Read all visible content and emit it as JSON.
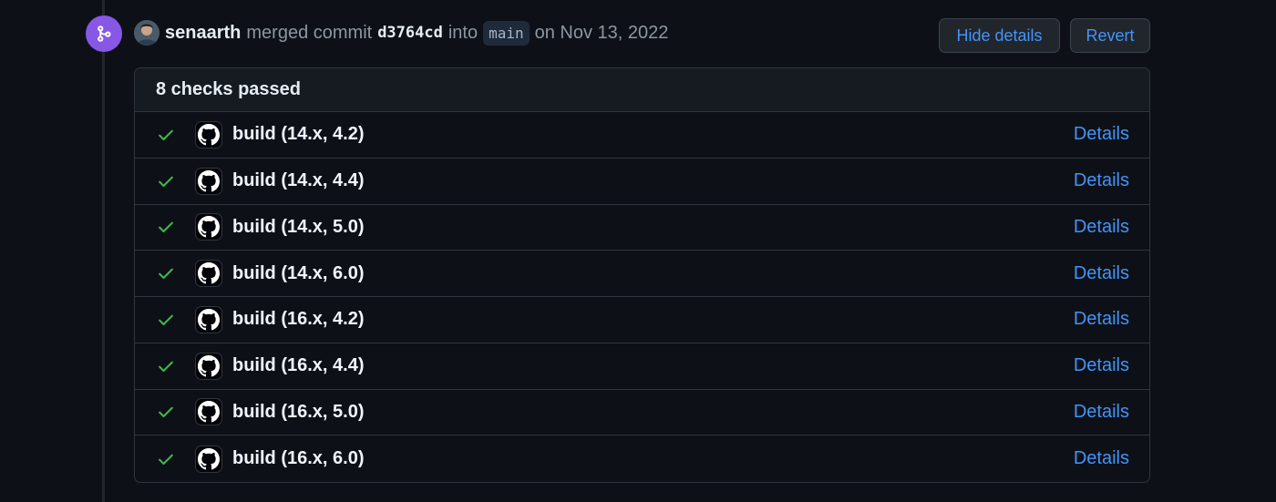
{
  "event": {
    "author": "senaarth",
    "verb": "merged commit",
    "sha": "d3764cd",
    "into": "into",
    "branch": "main",
    "date": "on Nov 13, 2022",
    "merge_badge_color": "#8957e5"
  },
  "buttons": {
    "hide_details": "Hide details",
    "revert": "Revert"
  },
  "checks": {
    "summary": "8 checks passed",
    "details_label": "Details",
    "status_color": "#3fb950",
    "link_color": "#4493f8",
    "items": [
      {
        "name": "build (14.x, 4.2)",
        "status": "success",
        "icon": "github-logo-icon"
      },
      {
        "name": "build (14.x, 4.4)",
        "status": "success",
        "icon": "github-logo-icon"
      },
      {
        "name": "build (14.x, 5.0)",
        "status": "success",
        "icon": "github-logo-icon"
      },
      {
        "name": "build (14.x, 6.0)",
        "status": "success",
        "icon": "github-logo-icon"
      },
      {
        "name": "build (16.x, 4.2)",
        "status": "success",
        "icon": "github-logo-icon"
      },
      {
        "name": "build (16.x, 4.4)",
        "status": "success",
        "icon": "github-logo-icon"
      },
      {
        "name": "build (16.x, 5.0)",
        "status": "success",
        "icon": "github-logo-icon"
      },
      {
        "name": "build (16.x, 6.0)",
        "status": "success",
        "icon": "github-logo-icon"
      }
    ]
  }
}
